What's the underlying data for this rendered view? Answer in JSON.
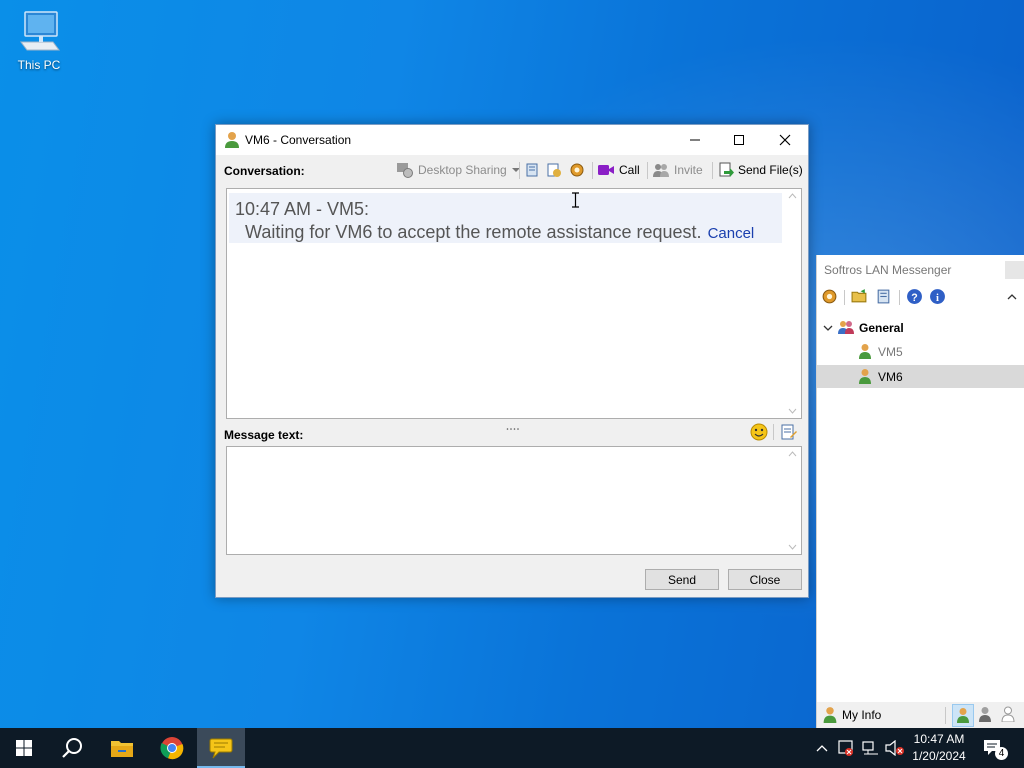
{
  "desktop": {
    "icon_label": "This PC"
  },
  "conversation_window": {
    "title": "VM6 - Conversation",
    "conversation_label": "Conversation:",
    "toolbar": {
      "desktop_sharing": "Desktop Sharing",
      "call": "Call",
      "invite": "Invite",
      "send_files": "Send File(s)"
    },
    "message": {
      "header": "10:47 AM - VM5:",
      "body": "Waiting for VM6 to accept the remote assistance request.",
      "cancel_link": "Cancel"
    },
    "splitter_glyph": "....",
    "message_text_label": "Message text:",
    "message_text_value": "",
    "send_button": "Send",
    "close_button": "Close"
  },
  "messenger_panel": {
    "title": "Softros LAN Messenger",
    "group": {
      "name": "General",
      "members": [
        {
          "name": "VM5",
          "selected": false
        },
        {
          "name": "VM6",
          "selected": true
        }
      ]
    },
    "my_info": "My Info"
  },
  "taskbar": {
    "time": "10:47 AM",
    "date": "1/20/2024",
    "notification_count": "4"
  },
  "colors": {
    "accent": "#0078d7",
    "link": "#1a3fae",
    "taskbar": "#0d1a26"
  }
}
